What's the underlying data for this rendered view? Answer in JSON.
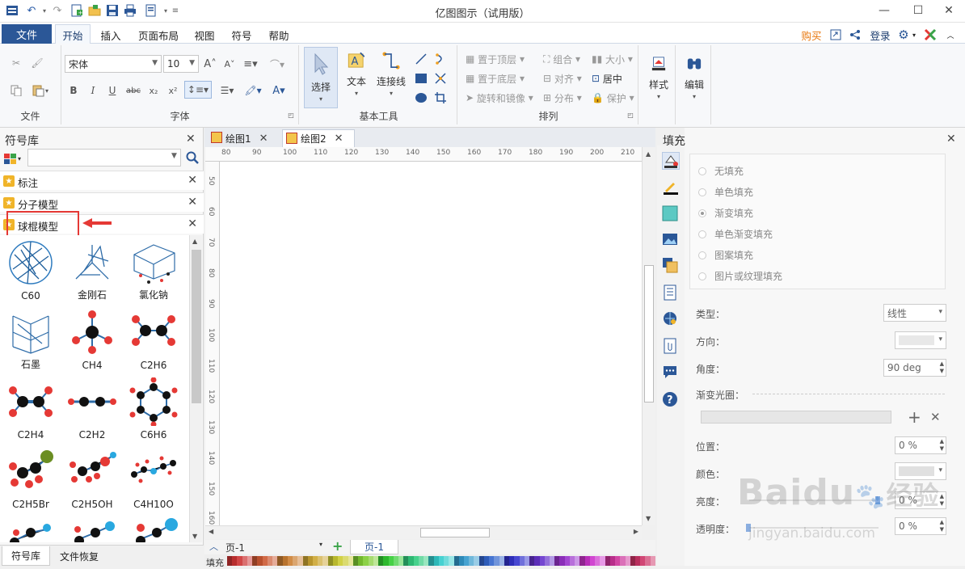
{
  "window": {
    "title": "亿图图示（试用版）"
  },
  "menu": {
    "file": "文件",
    "tabs": [
      "开始",
      "插入",
      "页面布局",
      "视图",
      "符号",
      "帮助"
    ],
    "buy": "购买",
    "login": "登录"
  },
  "ribbon": {
    "groups": {
      "file": "文件",
      "font": "字体",
      "basic_tools": "基本工具",
      "arrange": "排列"
    },
    "font_name": "宋体",
    "font_size": "10",
    "tools": {
      "select": "选择",
      "text": "文本",
      "connector": "连接线"
    },
    "arrange": {
      "bring_front": "置于顶层",
      "send_back": "置于底层",
      "rotate_mirror": "旋转和镜像",
      "group": "组合",
      "align": "对齐",
      "distribute": "分布",
      "size": "大小",
      "center": "居中",
      "protect": "保护"
    },
    "style": "样式",
    "edit": "编辑"
  },
  "left_panel": {
    "title": "符号库",
    "search_placeholder": "",
    "libraries": [
      "标注",
      "分子模型",
      "球棍模型"
    ],
    "symbols": [
      "C60",
      "金刚石",
      "氯化钠",
      "石墨",
      "CH4",
      "C2H6",
      "C2H4",
      "C2H2",
      "C6H6",
      "C2H5Br",
      "C2H5OH",
      "C4H10O"
    ],
    "bottom_tabs": [
      "符号库",
      "文件恢复"
    ]
  },
  "doc_tabs": [
    "绘图1",
    "绘图2"
  ],
  "ruler": {
    "h": [
      "80",
      "90",
      "100",
      "110",
      "120",
      "130",
      "140",
      "150",
      "160",
      "170",
      "180",
      "190",
      "200",
      "210"
    ],
    "v": [
      "50",
      "60",
      "70",
      "80",
      "90",
      "100",
      "110",
      "120",
      "130",
      "140",
      "150",
      "160"
    ]
  },
  "page_bar": {
    "page_select": "页-1",
    "page_tab": "页-1",
    "fill_label": "填充"
  },
  "right_panel": {
    "title": "填充",
    "fill_options": [
      "无填充",
      "单色填充",
      "渐变填充",
      "单色渐变填充",
      "图案填充",
      "图片或纹理填充"
    ],
    "selected_option": "渐变填充",
    "props": {
      "type_label": "类型：",
      "type_value": "线性",
      "direction_label": "方向：",
      "angle_label": "角度：",
      "angle_value": "90 deg",
      "stops_label": "渐变光圈：",
      "position_label": "位置：",
      "position_value": "0 %",
      "color_label": "颜色：",
      "brightness_label": "亮度：",
      "brightness_value": "0 %",
      "transparency_label": "透明度：",
      "transparency_value": "0 %"
    }
  },
  "watermark": {
    "brand": "Baidu",
    "brand_cn": "经验",
    "url": "jingyan.baidu.com"
  },
  "colors": {
    "accent": "#2b5797",
    "highlight_red": "#e53935",
    "buy_orange": "#e8770e"
  }
}
